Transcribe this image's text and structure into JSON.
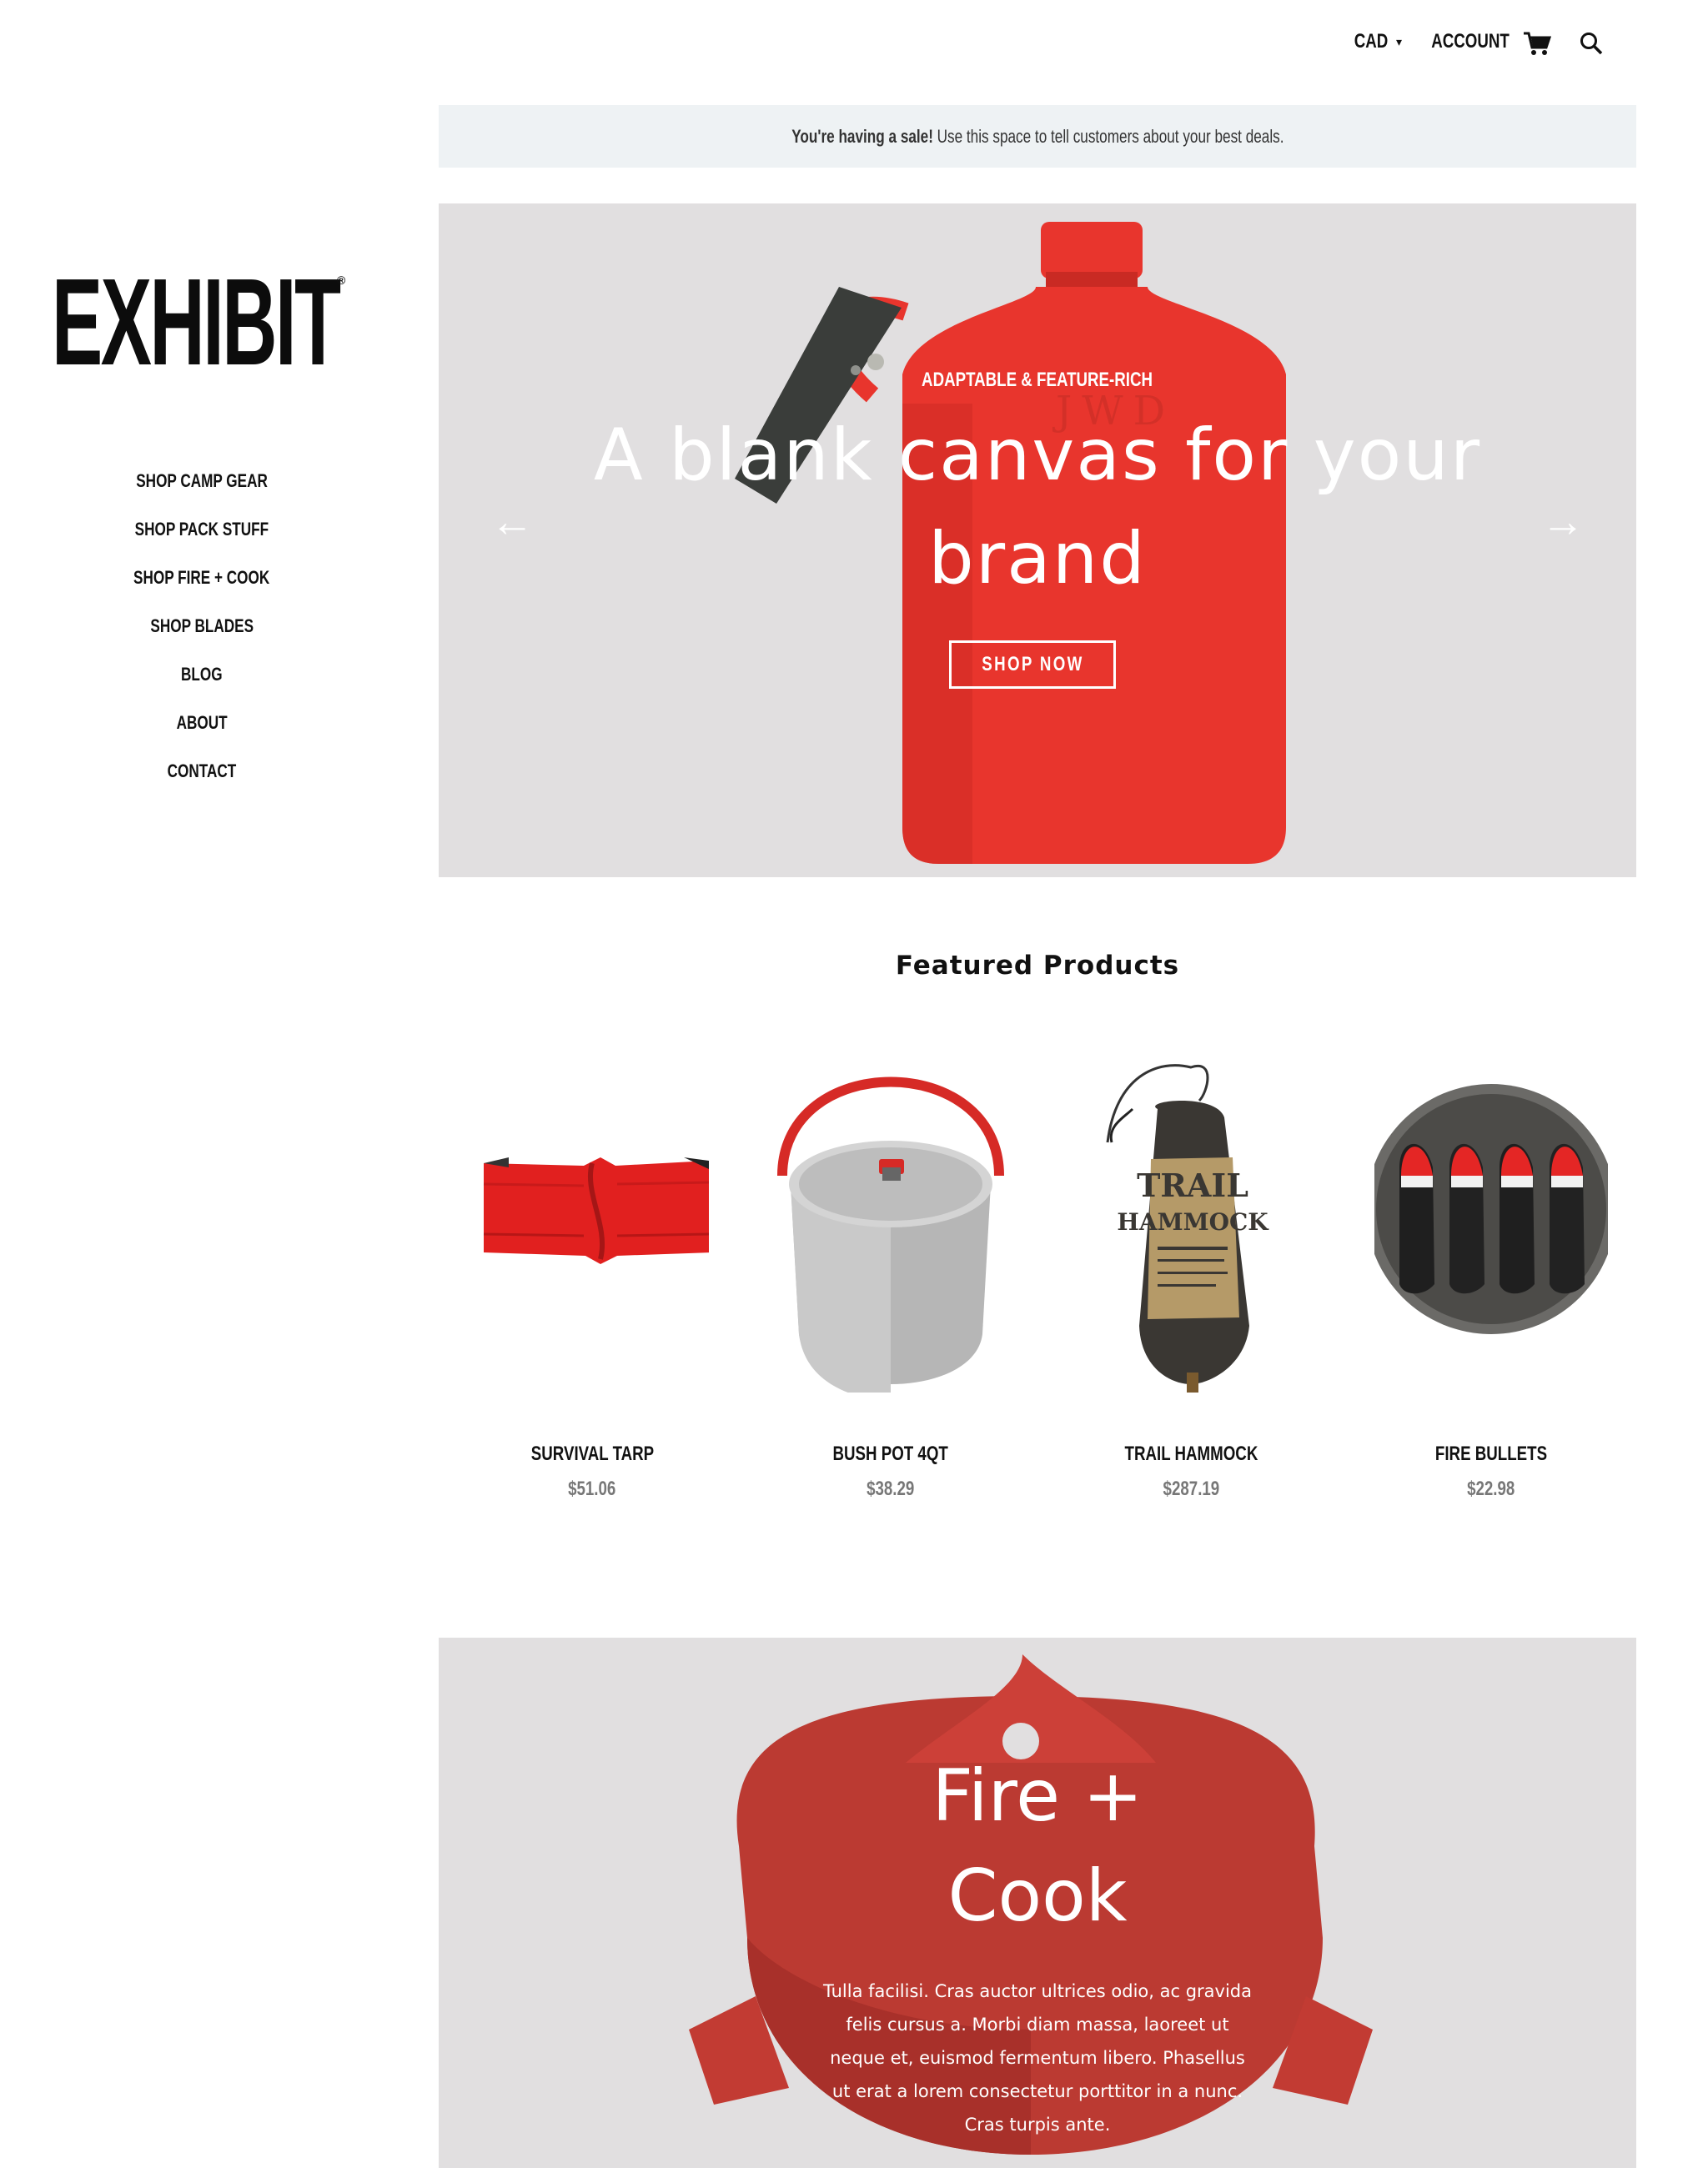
{
  "header": {
    "currency_label": "CAD",
    "account_label": "ACCOUNT",
    "cart_icon": "cart-icon",
    "search_icon": "search-icon"
  },
  "announcement": {
    "bold": "You're having a sale!",
    "text": "Use this space to tell customers about your best deals."
  },
  "brand": {
    "logo_text": "EXHIBIT",
    "logo_mark": "®"
  },
  "nav": {
    "items": [
      {
        "label": "SHOP CAMP GEAR"
      },
      {
        "label": "SHOP PACK STUFF"
      },
      {
        "label": "SHOP FIRE + COOK"
      },
      {
        "label": "SHOP BLADES"
      },
      {
        "label": "BLOG"
      },
      {
        "label": "ABOUT"
      },
      {
        "label": "CONTACT"
      }
    ]
  },
  "hero": {
    "kicker": "ADAPTABLE & FEATURE-RICH",
    "title": "A blank canvas for your brand",
    "cta": "SHOP NOW",
    "prev": "←",
    "next": "→",
    "bottle_engraving": "JWD",
    "colors": {
      "background": "#e1dfe0",
      "product": "#e8352d"
    }
  },
  "featured": {
    "title": "Featured Products",
    "products": [
      {
        "name": "SURVIVAL TARP",
        "price": "$51.06"
      },
      {
        "name": "BUSH POT 4QT",
        "price": "$38.29"
      },
      {
        "name": "TRAIL HAMMOCK",
        "price": "$287.19",
        "label_title": "TRAIL HAMMOCK"
      },
      {
        "name": "FIRE BULLETS",
        "price": "$22.98"
      }
    ]
  },
  "collection": {
    "title": "Fire + Cook",
    "text": "Tulla facilisi. Cras auctor ultrices odio, ac gravida felis cursus a. Morbi diam massa, laoreet ut neque et, euismod fermentum libero. Phasellus ut erat a lorem consectetur porttitor in a nunc. Cras turpis ante."
  }
}
